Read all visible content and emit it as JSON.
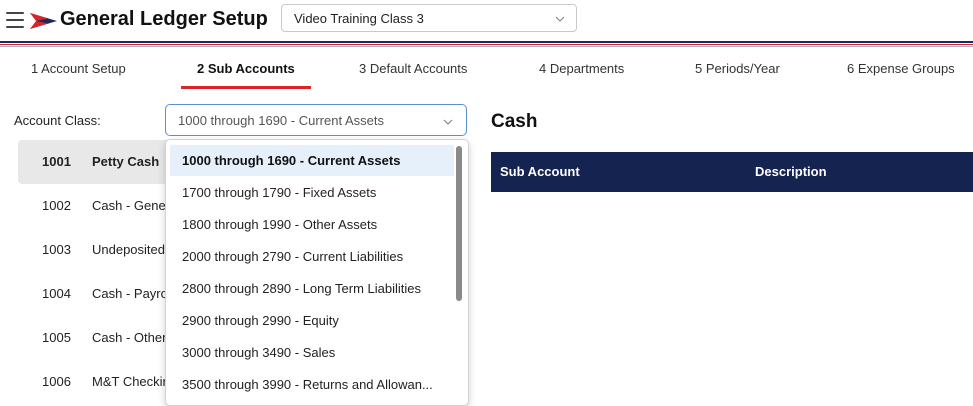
{
  "header": {
    "title": "General Ledger Setup",
    "company_select_value": "Video Training Class 3",
    "brand_colors": {
      "red": "#d9252a",
      "navy": "#1b2c5c"
    }
  },
  "tabs": [
    {
      "label": "1 Account Setup",
      "active": false
    },
    {
      "label": "2 Sub Accounts",
      "active": true
    },
    {
      "label": "3 Default Accounts",
      "active": false
    },
    {
      "label": "4 Departments",
      "active": false
    },
    {
      "label": "5 Periods/Year",
      "active": false
    },
    {
      "label": "6 Expense Groups",
      "active": false
    }
  ],
  "account_class": {
    "label": "Account Class:",
    "value": "1000 through 1690 - Current Assets",
    "options": [
      "1000 through 1690 - Current Assets",
      "1700 through 1790 - Fixed Assets",
      "1800 through 1990 - Other Assets",
      "2000 through 2790 - Current Liabilities",
      "2800 through 2890 - Long Term Liabilities",
      "2900 through 2990 - Equity",
      "3000 through 3490 - Sales",
      "3500 through 3990 - Returns and Allowan..."
    ],
    "selected_index": 0
  },
  "accounts": [
    {
      "number": "1001",
      "name": "Petty Cash",
      "selected": true
    },
    {
      "number": "1002",
      "name": "Cash - General",
      "selected": false
    },
    {
      "number": "1003",
      "name": "Undeposited",
      "selected": false
    },
    {
      "number": "1004",
      "name": "Cash - Payroll",
      "selected": false
    },
    {
      "number": "1005",
      "name": "Cash - Other",
      "selected": false
    },
    {
      "number": "1006",
      "name": "M&T Checking",
      "selected": false
    }
  ],
  "detail": {
    "title": "Cash",
    "columns": [
      "Sub Account",
      "Description"
    ],
    "header_color": "#14234f"
  }
}
